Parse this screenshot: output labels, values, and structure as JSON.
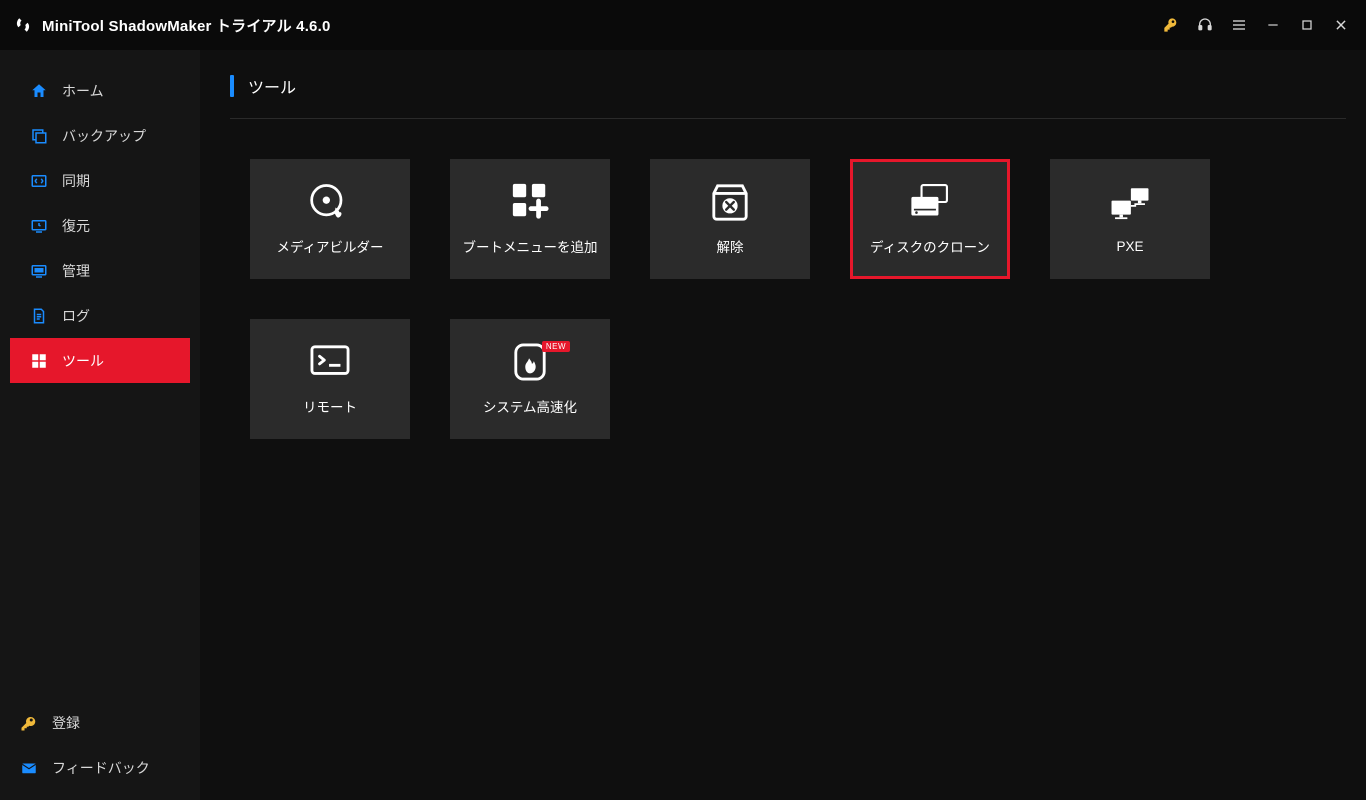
{
  "titlebar": {
    "title": "MiniTool ShadowMaker トライアル 4.6.0"
  },
  "sidebar": {
    "items": [
      {
        "label": "ホーム"
      },
      {
        "label": "バックアップ"
      },
      {
        "label": "同期"
      },
      {
        "label": "復元"
      },
      {
        "label": "管理"
      },
      {
        "label": "ログ"
      },
      {
        "label": "ツール"
      }
    ],
    "footer": [
      {
        "label": "登録"
      },
      {
        "label": "フィードバック"
      }
    ]
  },
  "page": {
    "title": "ツール"
  },
  "tiles": [
    {
      "label": "メディアビルダー"
    },
    {
      "label": "ブートメニューを追加"
    },
    {
      "label": "解除"
    },
    {
      "label": "ディスクのクローン"
    },
    {
      "label": "PXE"
    },
    {
      "label": "リモート"
    },
    {
      "label": "システム高速化",
      "badge": "NEW"
    }
  ]
}
